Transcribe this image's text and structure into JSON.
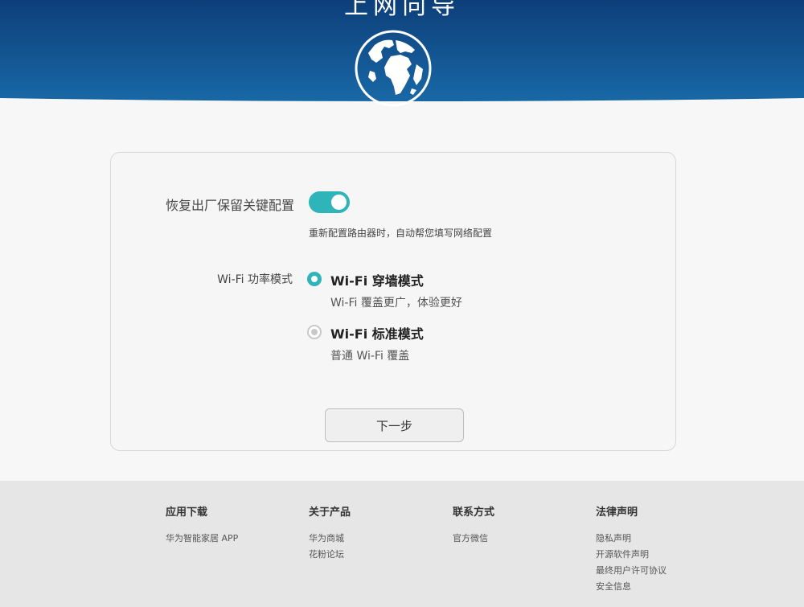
{
  "header": {
    "title": "上网向导",
    "colors": {
      "top": "#0d3f7a",
      "bottom": "#1868a6"
    }
  },
  "settings": {
    "restore_label": "恢复出厂保留关键配置",
    "restore_enabled": true,
    "restore_hint": "重新配置路由器时，自动帮您填写网络配置",
    "wifi_label": "Wi-Fi 功率模式",
    "options": [
      {
        "title": "Wi-Fi 穿墙模式",
        "desc": "Wi-Fi 覆盖更广，体验更好",
        "selected": true
      },
      {
        "title": "Wi-Fi 标准模式",
        "desc": "普通 Wi-Fi 覆盖",
        "selected": false
      }
    ],
    "next_label": "下一步",
    "accent": "#2fb4b9"
  },
  "footer": {
    "columns": [
      {
        "title": "应用下载",
        "links": [
          "华为智能家居 APP"
        ]
      },
      {
        "title": "关于产品",
        "links": [
          "华为商城",
          "花粉论坛"
        ]
      },
      {
        "title": "联系方式",
        "links": [
          "官方微信"
        ]
      },
      {
        "title": "法律声明",
        "links": [
          "隐私声明",
          "开源软件声明",
          "最终用户许可协议",
          "安全信息"
        ]
      }
    ]
  }
}
